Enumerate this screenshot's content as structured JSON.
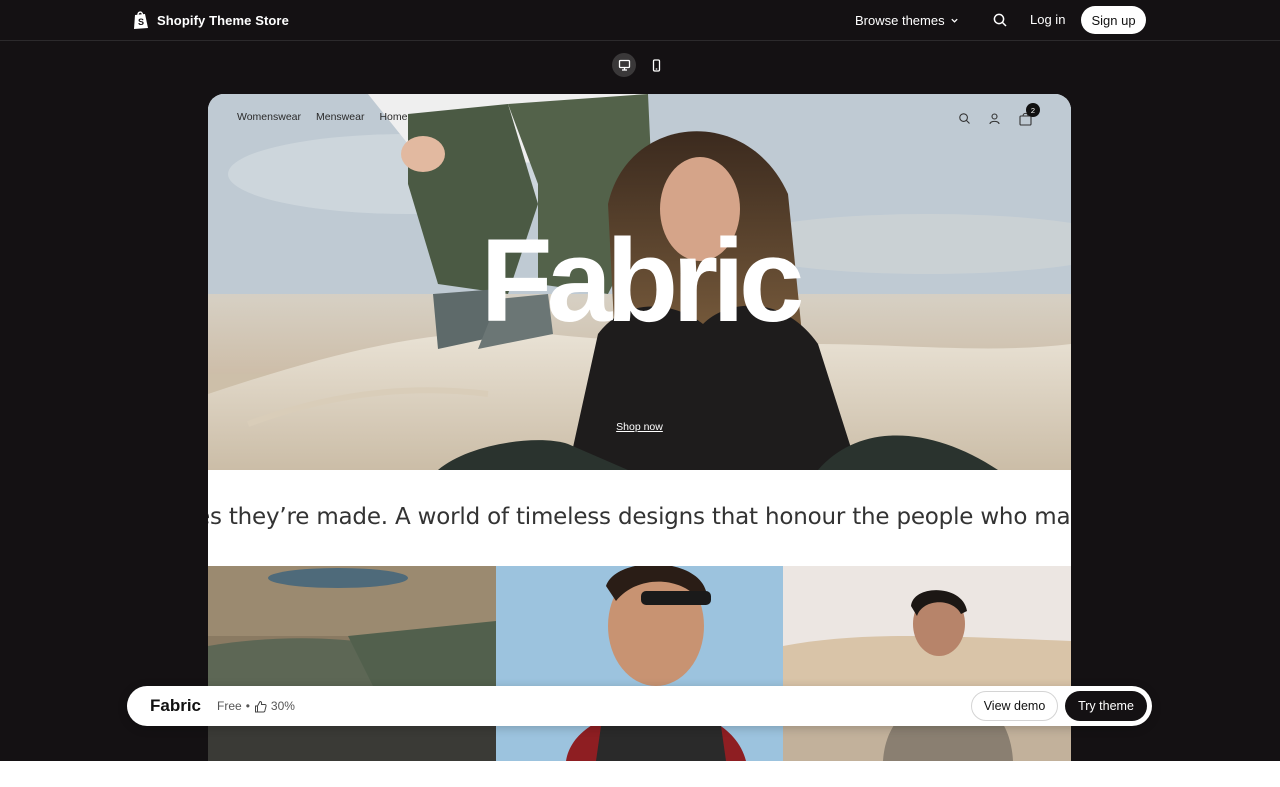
{
  "topnav": {
    "brand": "Shopify Theme Store",
    "browse_label": "Browse themes",
    "login_label": "Log in",
    "signup_label": "Sign up"
  },
  "device_toggle": {
    "active": "desktop"
  },
  "store": {
    "nav_items": [
      "Womenswear",
      "Menswear",
      "Home"
    ],
    "cart_count": "2",
    "hero_title": "Fabric",
    "shop_now": "Shop now",
    "marquee": "es they’re made.  A world of timeless designs that honour the people who make t"
  },
  "bar": {
    "theme_name": "Fabric",
    "price": "Free",
    "separator": "•",
    "rating": "30%",
    "view_demo_label": "View demo",
    "try_theme_label": "Try theme"
  },
  "colors": {
    "background_dark": "#141113",
    "accent_white": "#ffffff"
  }
}
